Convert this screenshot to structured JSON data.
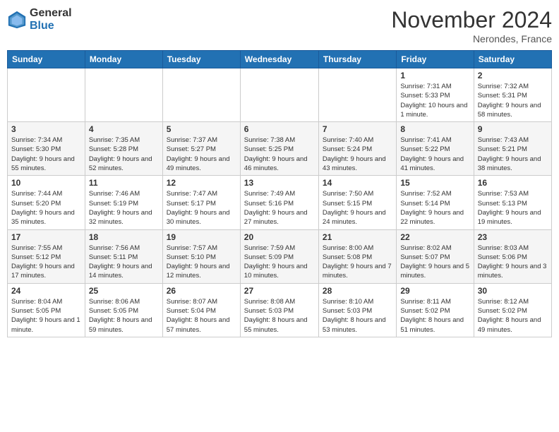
{
  "logo": {
    "general": "General",
    "blue": "Blue"
  },
  "header": {
    "month": "November 2024",
    "location": "Nerondes, France"
  },
  "weekdays": [
    "Sunday",
    "Monday",
    "Tuesday",
    "Wednesday",
    "Thursday",
    "Friday",
    "Saturday"
  ],
  "weeks": [
    [
      null,
      null,
      null,
      null,
      null,
      {
        "day": 1,
        "sunrise": "7:31 AM",
        "sunset": "5:33 PM",
        "daylight": "10 hours and 1 minute."
      },
      {
        "day": 2,
        "sunrise": "7:32 AM",
        "sunset": "5:31 PM",
        "daylight": "9 hours and 58 minutes."
      }
    ],
    [
      {
        "day": 3,
        "sunrise": "7:34 AM",
        "sunset": "5:30 PM",
        "daylight": "9 hours and 55 minutes."
      },
      {
        "day": 4,
        "sunrise": "7:35 AM",
        "sunset": "5:28 PM",
        "daylight": "9 hours and 52 minutes."
      },
      {
        "day": 5,
        "sunrise": "7:37 AM",
        "sunset": "5:27 PM",
        "daylight": "9 hours and 49 minutes."
      },
      {
        "day": 6,
        "sunrise": "7:38 AM",
        "sunset": "5:25 PM",
        "daylight": "9 hours and 46 minutes."
      },
      {
        "day": 7,
        "sunrise": "7:40 AM",
        "sunset": "5:24 PM",
        "daylight": "9 hours and 43 minutes."
      },
      {
        "day": 8,
        "sunrise": "7:41 AM",
        "sunset": "5:22 PM",
        "daylight": "9 hours and 41 minutes."
      },
      {
        "day": 9,
        "sunrise": "7:43 AM",
        "sunset": "5:21 PM",
        "daylight": "9 hours and 38 minutes."
      }
    ],
    [
      {
        "day": 10,
        "sunrise": "7:44 AM",
        "sunset": "5:20 PM",
        "daylight": "9 hours and 35 minutes."
      },
      {
        "day": 11,
        "sunrise": "7:46 AM",
        "sunset": "5:19 PM",
        "daylight": "9 hours and 32 minutes."
      },
      {
        "day": 12,
        "sunrise": "7:47 AM",
        "sunset": "5:17 PM",
        "daylight": "9 hours and 30 minutes."
      },
      {
        "day": 13,
        "sunrise": "7:49 AM",
        "sunset": "5:16 PM",
        "daylight": "9 hours and 27 minutes."
      },
      {
        "day": 14,
        "sunrise": "7:50 AM",
        "sunset": "5:15 PM",
        "daylight": "9 hours and 24 minutes."
      },
      {
        "day": 15,
        "sunrise": "7:52 AM",
        "sunset": "5:14 PM",
        "daylight": "9 hours and 22 minutes."
      },
      {
        "day": 16,
        "sunrise": "7:53 AM",
        "sunset": "5:13 PM",
        "daylight": "9 hours and 19 minutes."
      }
    ],
    [
      {
        "day": 17,
        "sunrise": "7:55 AM",
        "sunset": "5:12 PM",
        "daylight": "9 hours and 17 minutes."
      },
      {
        "day": 18,
        "sunrise": "7:56 AM",
        "sunset": "5:11 PM",
        "daylight": "9 hours and 14 minutes."
      },
      {
        "day": 19,
        "sunrise": "7:57 AM",
        "sunset": "5:10 PM",
        "daylight": "9 hours and 12 minutes."
      },
      {
        "day": 20,
        "sunrise": "7:59 AM",
        "sunset": "5:09 PM",
        "daylight": "9 hours and 10 minutes."
      },
      {
        "day": 21,
        "sunrise": "8:00 AM",
        "sunset": "5:08 PM",
        "daylight": "9 hours and 7 minutes."
      },
      {
        "day": 22,
        "sunrise": "8:02 AM",
        "sunset": "5:07 PM",
        "daylight": "9 hours and 5 minutes."
      },
      {
        "day": 23,
        "sunrise": "8:03 AM",
        "sunset": "5:06 PM",
        "daylight": "9 hours and 3 minutes."
      }
    ],
    [
      {
        "day": 24,
        "sunrise": "8:04 AM",
        "sunset": "5:05 PM",
        "daylight": "9 hours and 1 minute."
      },
      {
        "day": 25,
        "sunrise": "8:06 AM",
        "sunset": "5:05 PM",
        "daylight": "8 hours and 59 minutes."
      },
      {
        "day": 26,
        "sunrise": "8:07 AM",
        "sunset": "5:04 PM",
        "daylight": "8 hours and 57 minutes."
      },
      {
        "day": 27,
        "sunrise": "8:08 AM",
        "sunset": "5:03 PM",
        "daylight": "8 hours and 55 minutes."
      },
      {
        "day": 28,
        "sunrise": "8:10 AM",
        "sunset": "5:03 PM",
        "daylight": "8 hours and 53 minutes."
      },
      {
        "day": 29,
        "sunrise": "8:11 AM",
        "sunset": "5:02 PM",
        "daylight": "8 hours and 51 minutes."
      },
      {
        "day": 30,
        "sunrise": "8:12 AM",
        "sunset": "5:02 PM",
        "daylight": "8 hours and 49 minutes."
      }
    ]
  ]
}
